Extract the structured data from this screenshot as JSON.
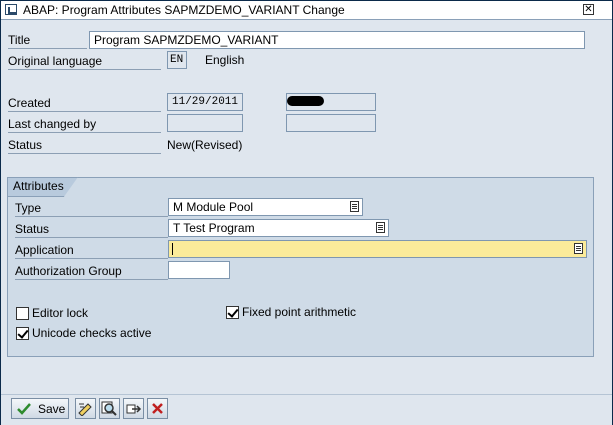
{
  "window": {
    "title": "ABAP: Program Attributes SAPMZDEMO_VARIANT Change",
    "title_icon": "window-icon",
    "close_icon": "close-icon"
  },
  "header": {
    "title_label": "Title",
    "title_value": "Program SAPMZDEMO_VARIANT",
    "orig_lang_label": "Original language",
    "orig_lang_code": "EN",
    "orig_lang_name": "English",
    "created_label": "Created",
    "created_date": "11/29/2011",
    "created_by": "",
    "last_changed_label": "Last changed by",
    "last_changed_date": "",
    "last_changed_by": "",
    "status_label": "Status",
    "status_value": "New(Revised)"
  },
  "attributes": {
    "group_title": "Attributes",
    "type_label": "Type",
    "type_value": "M Module Pool",
    "status_label": "Status",
    "status_value": "T Test Program",
    "application_label": "Application",
    "application_value": "",
    "auth_group_label": "Authorization Group",
    "auth_group_value": "",
    "editor_lock_label": "Editor lock",
    "editor_lock_checked": false,
    "unicode_label": "Unicode checks active",
    "unicode_checked": true,
    "fixed_point_label": "Fixed point arithmetic",
    "fixed_point_checked": true
  },
  "toolbar": {
    "save_label": "Save",
    "icons": [
      "checkmark-icon",
      "texts-icon",
      "where-used-icon",
      "transport-icon",
      "cancel-icon"
    ]
  }
}
